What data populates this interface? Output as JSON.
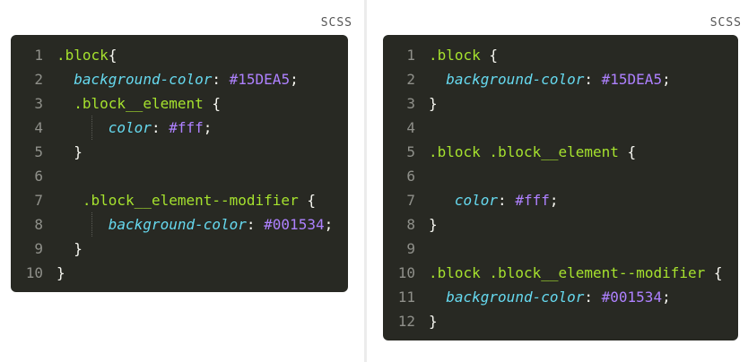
{
  "left_panel": {
    "language": "SCSS",
    "lines": [
      {
        "number": "1",
        "indent": 0,
        "guides": [],
        "tokens": [
          {
            "t": ".block",
            "k": "sel"
          },
          {
            "t": "{",
            "k": "pun"
          }
        ]
      },
      {
        "number": "2",
        "indent": 2,
        "guides": [],
        "tokens": [
          {
            "t": "background-color",
            "k": "prop"
          },
          {
            "t": ": ",
            "k": "pun"
          },
          {
            "t": "#15DEA5",
            "k": "val"
          },
          {
            "t": ";",
            "k": "pun"
          }
        ]
      },
      {
        "number": "3",
        "indent": 2,
        "guides": [],
        "tokens": [
          {
            "t": ".block__element",
            "k": "sel"
          },
          {
            "t": " {",
            "k": "pun"
          }
        ]
      },
      {
        "number": "4",
        "indent": 6,
        "guides": [
          4
        ],
        "tokens": [
          {
            "t": "color",
            "k": "prop"
          },
          {
            "t": ": ",
            "k": "pun"
          },
          {
            "t": "#fff",
            "k": "val"
          },
          {
            "t": ";",
            "k": "pun"
          }
        ]
      },
      {
        "number": "5",
        "indent": 2,
        "guides": [],
        "tokens": [
          {
            "t": "}",
            "k": "pun"
          }
        ]
      },
      {
        "number": "6",
        "indent": 0,
        "guides": [],
        "tokens": []
      },
      {
        "number": "7",
        "indent": 3,
        "guides": [],
        "tokens": [
          {
            "t": ".block__element--modifier",
            "k": "sel"
          },
          {
            "t": " {",
            "k": "pun"
          }
        ]
      },
      {
        "number": "8",
        "indent": 6,
        "guides": [
          4
        ],
        "tokens": [
          {
            "t": "background-color",
            "k": "prop"
          },
          {
            "t": ": ",
            "k": "pun"
          },
          {
            "t": "#001534",
            "k": "val"
          },
          {
            "t": ";",
            "k": "pun"
          }
        ]
      },
      {
        "number": "9",
        "indent": 2,
        "guides": [],
        "tokens": [
          {
            "t": "}",
            "k": "pun"
          }
        ]
      },
      {
        "number": "10",
        "indent": 0,
        "guides": [],
        "tokens": [
          {
            "t": "}",
            "k": "pun"
          }
        ]
      }
    ]
  },
  "right_panel": {
    "language": "SCSS",
    "lines": [
      {
        "number": "1",
        "indent": 0,
        "guides": [],
        "tokens": [
          {
            "t": ".block",
            "k": "sel"
          },
          {
            "t": " {",
            "k": "pun"
          }
        ]
      },
      {
        "number": "2",
        "indent": 2,
        "guides": [],
        "tokens": [
          {
            "t": "background-color",
            "k": "prop"
          },
          {
            "t": ": ",
            "k": "pun"
          },
          {
            "t": "#15DEA5",
            "k": "val"
          },
          {
            "t": ";",
            "k": "pun"
          }
        ]
      },
      {
        "number": "3",
        "indent": 0,
        "guides": [],
        "tokens": [
          {
            "t": "}",
            "k": "pun"
          }
        ]
      },
      {
        "number": "4",
        "indent": 0,
        "guides": [],
        "tokens": []
      },
      {
        "number": "5",
        "indent": 0,
        "guides": [],
        "tokens": [
          {
            "t": ".block .block__element",
            "k": "sel"
          },
          {
            "t": " {",
            "k": "pun"
          }
        ]
      },
      {
        "number": "6",
        "indent": 0,
        "guides": [],
        "tokens": []
      },
      {
        "number": "7",
        "indent": 3,
        "guides": [],
        "tokens": [
          {
            "t": "color",
            "k": "prop"
          },
          {
            "t": ": ",
            "k": "pun"
          },
          {
            "t": "#fff",
            "k": "val"
          },
          {
            "t": ";",
            "k": "pun"
          }
        ]
      },
      {
        "number": "8",
        "indent": 0,
        "guides": [],
        "tokens": [
          {
            "t": "}",
            "k": "pun"
          }
        ]
      },
      {
        "number": "9",
        "indent": 0,
        "guides": [],
        "tokens": []
      },
      {
        "number": "10",
        "indent": 0,
        "guides": [],
        "tokens": [
          {
            "t": ".block .block__element--modifier",
            "k": "sel"
          },
          {
            "t": " {",
            "k": "pun"
          }
        ]
      },
      {
        "number": "11",
        "indent": 2,
        "guides": [],
        "tokens": [
          {
            "t": "background-color",
            "k": "prop"
          },
          {
            "t": ": ",
            "k": "pun"
          },
          {
            "t": "#001534",
            "k": "val"
          },
          {
            "t": ";",
            "k": "pun"
          }
        ]
      },
      {
        "number": "12",
        "indent": 0,
        "guides": [],
        "tokens": [
          {
            "t": "}",
            "k": "pun"
          }
        ]
      }
    ]
  },
  "theme": {
    "background": "#282923",
    "line_number": "#8f908a",
    "selector": "#a6e22e",
    "property": "#66d9ef",
    "value": "#ae81ff",
    "punctuation": "#f8f8f2"
  }
}
